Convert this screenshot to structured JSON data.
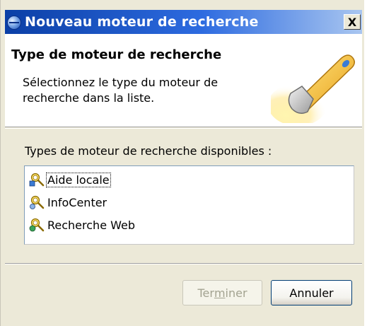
{
  "window": {
    "title": "Nouveau moteur de recherche",
    "close_label": "X"
  },
  "header": {
    "title": "Type de moteur de recherche",
    "description": "Sélectionnez le type du moteur de recherche dans la liste."
  },
  "list": {
    "label": "Types de moteur de recherche disponibles :",
    "items": [
      {
        "label": "Aide locale",
        "icon": "search-engine-local-icon",
        "focused": true
      },
      {
        "label": "InfoCenter",
        "icon": "search-engine-infocenter-icon",
        "focused": false
      },
      {
        "label": "Recherche Web",
        "icon": "search-engine-web-icon",
        "focused": false
      }
    ]
  },
  "buttons": {
    "finish": {
      "label_pre": "Ter",
      "label_mnemonic": "m",
      "label_post": "iner",
      "enabled": false
    },
    "cancel": {
      "label": "Annuler"
    }
  },
  "colors": {
    "titlebar_start": "#0b3fa6",
    "titlebar_end": "#a9c6f0",
    "dialog_background": "#ece9d8"
  }
}
